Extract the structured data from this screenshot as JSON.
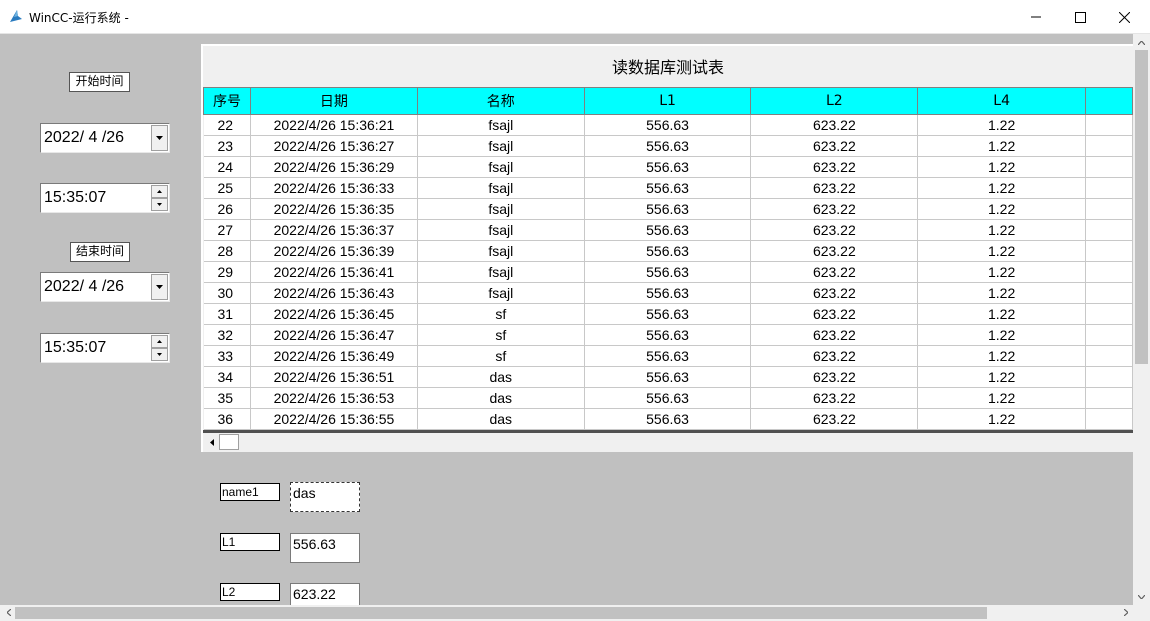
{
  "window": {
    "title": "WinCC-运行系统 -"
  },
  "filters": {
    "start_label": "开始时间",
    "start_date": "2022/ 4 /26",
    "start_time": "15:35:07",
    "end_label": "结束时间",
    "end_date": "2022/ 4 /26",
    "end_time": "15:35:07"
  },
  "table": {
    "title": "读数据库测试表",
    "columns": [
      "序号",
      "日期",
      "名称",
      "L1",
      "L2",
      "L4",
      ""
    ],
    "rows": [
      [
        "22",
        "2022/4/26 15:36:21",
        "fsajl",
        "556.63",
        "623.22",
        "1.22",
        ""
      ],
      [
        "23",
        "2022/4/26 15:36:27",
        "fsajl",
        "556.63",
        "623.22",
        "1.22",
        ""
      ],
      [
        "24",
        "2022/4/26 15:36:29",
        "fsajl",
        "556.63",
        "623.22",
        "1.22",
        ""
      ],
      [
        "25",
        "2022/4/26 15:36:33",
        "fsajl",
        "556.63",
        "623.22",
        "1.22",
        ""
      ],
      [
        "26",
        "2022/4/26 15:36:35",
        "fsajl",
        "556.63",
        "623.22",
        "1.22",
        ""
      ],
      [
        "27",
        "2022/4/26 15:36:37",
        "fsajl",
        "556.63",
        "623.22",
        "1.22",
        ""
      ],
      [
        "28",
        "2022/4/26 15:36:39",
        "fsajl",
        "556.63",
        "623.22",
        "1.22",
        ""
      ],
      [
        "29",
        "2022/4/26 15:36:41",
        "fsajl",
        "556.63",
        "623.22",
        "1.22",
        ""
      ],
      [
        "30",
        "2022/4/26 15:36:43",
        "fsajl",
        "556.63",
        "623.22",
        "1.22",
        ""
      ],
      [
        "31",
        "2022/4/26 15:36:45",
        "sf",
        "556.63",
        "623.22",
        "1.22",
        ""
      ],
      [
        "32",
        "2022/4/26 15:36:47",
        "sf",
        "556.63",
        "623.22",
        "1.22",
        ""
      ],
      [
        "33",
        "2022/4/26 15:36:49",
        "sf",
        "556.63",
        "623.22",
        "1.22",
        ""
      ],
      [
        "34",
        "2022/4/26 15:36:51",
        "das",
        "556.63",
        "623.22",
        "1.22",
        ""
      ],
      [
        "35",
        "2022/4/26 15:36:53",
        "das",
        "556.63",
        "623.22",
        "1.22",
        ""
      ],
      [
        "36",
        "2022/4/26 15:36:55",
        "das",
        "556.63",
        "623.22",
        "1.22",
        ""
      ]
    ]
  },
  "fields": {
    "name_label": "name1",
    "name_value": "das",
    "l1_label": "L1",
    "l1_value": "556.63",
    "l2_label": "L2",
    "l2_value": "623.22"
  },
  "icons": {
    "app": "wincc-app-icon",
    "minimize": "minimize-icon",
    "maximize": "maximize-icon",
    "close": "close-icon"
  },
  "colors": {
    "header_bg": "#00ffff",
    "background": "#c0c0c0"
  }
}
